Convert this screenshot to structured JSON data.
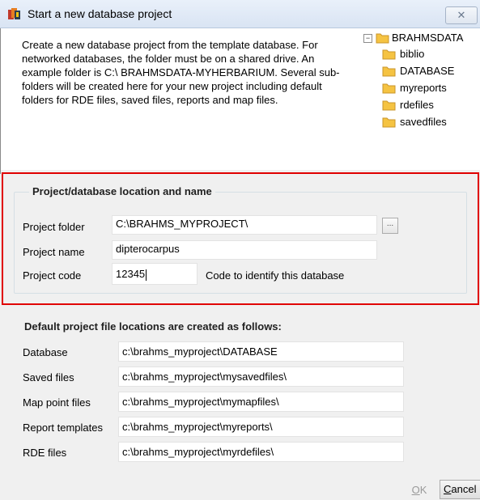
{
  "window": {
    "title": "Start a new database project",
    "close_glyph": "✕"
  },
  "intro": {
    "text": "Create a new database project from the template database. For networked databases, the folder must be on a shared drive.  An example folder is C:\\ BRAHMSDATA-MYHERBARIUM.  Several sub-folders will be created here for your new project including default folders for RDE files, saved files, reports and map files."
  },
  "tree": {
    "root": "BRAHMSDATA",
    "children": [
      "biblio",
      "DATABASE",
      "myreports",
      "rdefiles",
      "savedfiles"
    ]
  },
  "project_group": {
    "title": "Project/database location and name",
    "folder_label": "Project folder",
    "folder_value": "C:\\BRAHMS_MYPROJECT\\",
    "browse_label": "...",
    "name_label": "Project name",
    "name_value": "dipterocarpus",
    "code_label": "Project code",
    "code_value": "12345",
    "code_hint": "Code to identify this database"
  },
  "locations": {
    "heading": "Default project file locations are created as follows:",
    "rows": [
      {
        "label": "Database",
        "value": "c:\\brahms_myproject\\DATABASE"
      },
      {
        "label": "Saved files",
        "value": "c:\\brahms_myproject\\mysavedfiles\\"
      },
      {
        "label": "Map point files",
        "value": "c:\\brahms_myproject\\mymapfiles\\"
      },
      {
        "label": "Report templates",
        "value": "c:\\brahms_myproject\\myreports\\"
      },
      {
        "label": "RDE files",
        "value": "c:\\brahms_myproject\\myrdefiles\\"
      }
    ]
  },
  "buttons": {
    "ok_first": "O",
    "ok_rest": "K",
    "cancel_first": "C",
    "cancel_rest": "ancel"
  },
  "colors": {
    "highlight": "#e00000",
    "folder": "#f5c342"
  }
}
